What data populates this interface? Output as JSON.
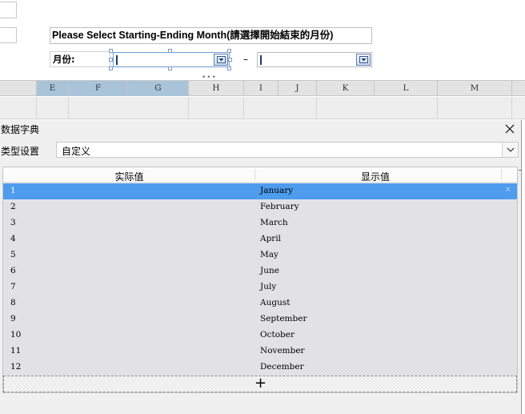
{
  "sheet": {
    "title_text": "Please Select Starting-Ending  Month(請選擇開始結束的月份)",
    "month_label": "月份:",
    "range_separator": "–",
    "grip": "•••",
    "columns": [
      "E",
      "F",
      "G",
      "H",
      "I",
      "J",
      "K",
      "L",
      "M"
    ]
  },
  "dialog": {
    "title": "数据字典",
    "type_label": "类型设置",
    "type_value": "自定义",
    "table": {
      "col_actual": "实际值",
      "col_display": "显示值",
      "rows": [
        {
          "actual": "1",
          "display": "January"
        },
        {
          "actual": "2",
          "display": "February"
        },
        {
          "actual": "3",
          "display": "March"
        },
        {
          "actual": "4",
          "display": "April"
        },
        {
          "actual": "5",
          "display": "May"
        },
        {
          "actual": "6",
          "display": "June"
        },
        {
          "actual": "7",
          "display": "July"
        },
        {
          "actual": "8",
          "display": "August"
        },
        {
          "actual": "9",
          "display": "September"
        },
        {
          "actual": "10",
          "display": "October"
        },
        {
          "actual": "11",
          "display": "November"
        },
        {
          "actual": "12",
          "display": "December"
        }
      ],
      "selected_row": 0,
      "add_symbol": "+",
      "delete_symbol": "✕"
    }
  },
  "colors": {
    "selection": "#4e9cee",
    "column_highlight": "#a9c4d8",
    "dialog_bg": "#f0f0f0"
  }
}
